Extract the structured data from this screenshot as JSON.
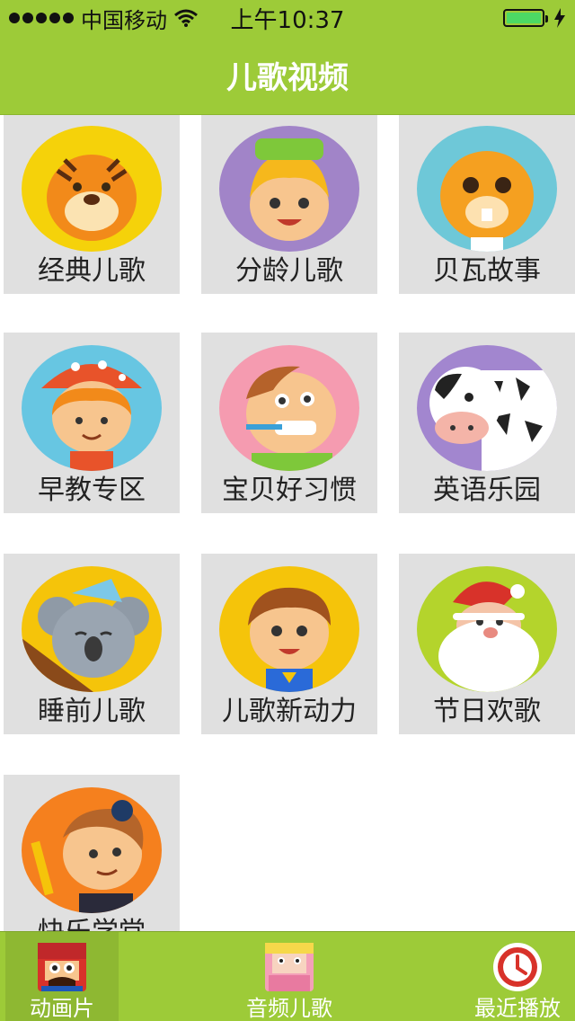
{
  "status_bar": {
    "carrier": "中国移动",
    "time": "上午10:37",
    "battery_level": 1.0
  },
  "nav": {
    "title": "儿歌视频"
  },
  "categories": [
    {
      "label": "经典儿歌",
      "bg": "#f5d20a",
      "icon": "tiger-icon"
    },
    {
      "label": "分龄儿歌",
      "bg": "#a184c8",
      "icon": "counting-girl-icon"
    },
    {
      "label": "贝瓦故事",
      "bg": "#6ec8d8",
      "icon": "beaver-icon"
    },
    {
      "label": "早教专区",
      "bg": "#67c6e2",
      "icon": "mushroom-girl-icon"
    },
    {
      "label": "宝贝好习惯",
      "bg": "#f59bb0",
      "icon": "toothbrush-boy-icon"
    },
    {
      "label": "英语乐园",
      "bg": "#a286cf",
      "icon": "cow-abc-icon"
    },
    {
      "label": "睡前儿歌",
      "bg": "#f5c40a",
      "icon": "koala-icon"
    },
    {
      "label": "儿歌新动力",
      "bg": "#f5c40a",
      "icon": "superhero-boy-icon"
    },
    {
      "label": "节日欢歌",
      "bg": "#b4d42c",
      "icon": "santa-icon"
    },
    {
      "label": "快乐学堂",
      "bg": "#f5801e",
      "icon": "pencil-boy-icon"
    }
  ],
  "tabs": [
    {
      "label": "动画片",
      "icon": "cartoon-icon",
      "active": true
    },
    {
      "label": "音频儿歌",
      "icon": "audio-doll-icon",
      "active": false
    },
    {
      "label": "最近播放",
      "icon": "clock-icon",
      "active": false
    }
  ],
  "colors": {
    "accent": "#9dcb38",
    "card_bg": "#e0e0e0"
  }
}
